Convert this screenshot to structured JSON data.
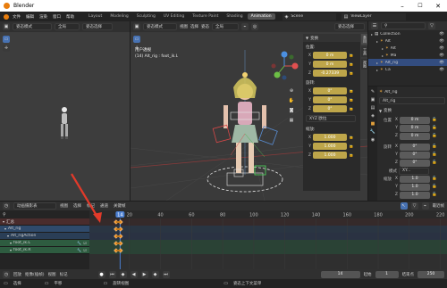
{
  "window": {
    "title": "Blender"
  },
  "menu": [
    "文件",
    "编辑",
    "渲染",
    "窗口",
    "帮助"
  ],
  "workspaces": [
    {
      "label": "Layout",
      "active": false
    },
    {
      "label": "Modeling",
      "active": false
    },
    {
      "label": "Sculpting",
      "active": false
    },
    {
      "label": "UV Editing",
      "active": false
    },
    {
      "label": "Texture Paint",
      "active": false
    },
    {
      "label": "Shading",
      "active": false
    },
    {
      "label": "Animation",
      "active": true
    }
  ],
  "scene": "Scene",
  "view_layer": "ViewLayer",
  "left_header": {
    "mode": "姿态模式",
    "pivot": "全局",
    "snap": "姿态选择"
  },
  "viewport": {
    "mode": "姿态模式",
    "view": "视图",
    "select": "选择",
    "pose": "姿态",
    "orientation": "全局",
    "snap": "姿态选择",
    "info_line1": "用户透视",
    "info_line2": "(14) Alt_rig : foot_ik.L",
    "gizmo_axes": [
      "X",
      "Y",
      "Z"
    ]
  },
  "npanel": {
    "header": "变换",
    "location_label": "位置:",
    "location": [
      {
        "axis": "X",
        "value": "0 m"
      },
      {
        "axis": "Y",
        "value": "0 m"
      },
      {
        "axis": "Z",
        "value": "-0.27339"
      }
    ],
    "rotation_label": "旋转:",
    "rotation": [
      {
        "axis": "X",
        "value": "0°"
      },
      {
        "axis": "Y",
        "value": "0°"
      },
      {
        "axis": "Z",
        "value": "0°"
      }
    ],
    "rotation_mode": "XYZ 欧拉",
    "scale_label": "缩放:",
    "scale": [
      {
        "axis": "X",
        "value": "1.000"
      },
      {
        "axis": "Y",
        "value": "1.000"
      },
      {
        "axis": "Z",
        "value": "1.000"
      }
    ],
    "tabs": [
      "条目",
      "工具",
      "视图"
    ]
  },
  "outliner": {
    "items": [
      {
        "label": "Collection",
        "depth": 0
      },
      {
        "label": "Alt",
        "depth": 1
      },
      {
        "label": "Alt",
        "depth": 2
      },
      {
        "label": "Ma",
        "depth": 2
      },
      {
        "label": "Alt_rig",
        "depth": 1
      },
      {
        "label": "Ca",
        "depth": 1
      }
    ]
  },
  "properties": {
    "object": "Alt_rig",
    "name": "Alt_rig",
    "transform": "变换",
    "location_label": "位置",
    "location": [
      {
        "axis": "X",
        "value": "0 m"
      },
      {
        "axis": "Y",
        "value": "0 m"
      },
      {
        "axis": "Z",
        "value": "0 m"
      }
    ],
    "rotation_label": "旋转",
    "rotation": [
      {
        "axis": "X",
        "value": "0°"
      },
      {
        "axis": "Y",
        "value": "0°"
      },
      {
        "axis": "Z",
        "value": "0°"
      }
    ],
    "mode_label": "模式",
    "mode": "XY...",
    "scale_label": "缩放",
    "scale": [
      {
        "axis": "X",
        "value": "1.0"
      },
      {
        "axis": "Y",
        "value": "1.0"
      },
      {
        "axis": "Z",
        "value": "1.0"
      }
    ]
  },
  "dopesheet": {
    "editor": "动画摄影表",
    "menus": [
      "视图",
      "选择",
      "标记",
      "通道",
      "关键帧"
    ],
    "nearest": "最近帧",
    "current_frame": "14",
    "ticks": [
      "20",
      "40",
      "60",
      "80",
      "100",
      "120",
      "140",
      "160",
      "180",
      "200",
      "220"
    ],
    "channels": [
      {
        "label": "汇总",
        "type": "summary"
      },
      {
        "label": "Alt_rig",
        "type": "object"
      },
      {
        "label": "Alt_rigAction",
        "type": "action"
      },
      {
        "label": "foot_ik.L",
        "type": "group"
      },
      {
        "label": "foot_ik.R",
        "type": "group"
      }
    ]
  },
  "playback": {
    "playback_label": "回放",
    "keying_label": "抠像(插帧)",
    "view": "视图",
    "marker": "标记",
    "frame": "14",
    "start_label": "起始",
    "start": "1",
    "end_label": "结束点",
    "end": "250"
  },
  "statusbar": {
    "select": "选择",
    "pan": "平移",
    "menu": "旋转视图",
    "context": "姿态上下文菜单"
  },
  "colors": {
    "accent": "#e19c3c",
    "selected_tab": "#4772b3",
    "key_orange": "#ff9e2c",
    "red_arrow": "#e23a2a"
  }
}
